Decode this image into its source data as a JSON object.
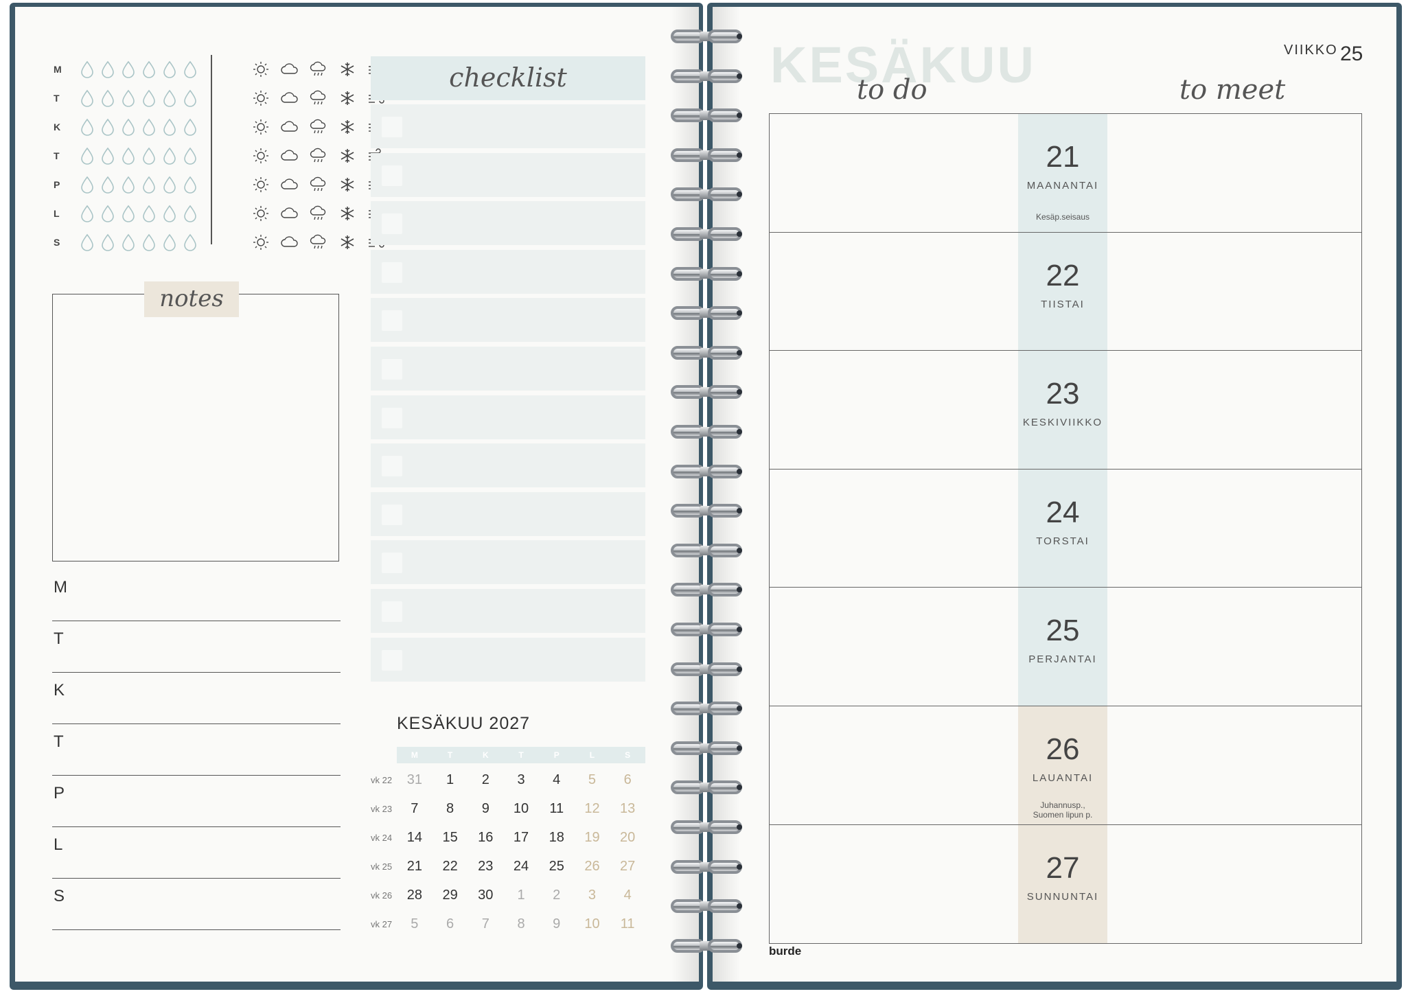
{
  "tracker": {
    "days": [
      "M",
      "T",
      "K",
      "T",
      "P",
      "L",
      "S"
    ],
    "drops_per_day": 6,
    "weather_icons": [
      "sun-icon",
      "cloud-icon",
      "rain-icon",
      "snow-icon",
      "wind-icon"
    ]
  },
  "notes": {
    "title": "notes"
  },
  "weekday_lines": [
    "M",
    "T",
    "K",
    "T",
    "P",
    "L",
    "S"
  ],
  "checklist": {
    "title": "checklist",
    "rows": 12
  },
  "mini_calendar": {
    "title": "KESÄKUU 2027",
    "headers": [
      "M",
      "T",
      "K",
      "T",
      "P",
      "L",
      "S"
    ],
    "weeks": [
      {
        "label": "vk 22",
        "days": [
          "31",
          "1",
          "2",
          "3",
          "4",
          "5",
          "6"
        ]
      },
      {
        "label": "vk 23",
        "days": [
          "7",
          "8",
          "9",
          "10",
          "11",
          "12",
          "13"
        ]
      },
      {
        "label": "vk 24",
        "days": [
          "14",
          "15",
          "16",
          "17",
          "18",
          "19",
          "20"
        ]
      },
      {
        "label": "vk 25",
        "days": [
          "21",
          "22",
          "23",
          "24",
          "25",
          "26",
          "27"
        ]
      },
      {
        "label": "vk 26",
        "days": [
          "28",
          "29",
          "30",
          "1",
          "2",
          "3",
          "4"
        ]
      },
      {
        "label": "vk 27",
        "days": [
          "5",
          "6",
          "7",
          "8",
          "9",
          "10",
          "11"
        ]
      }
    ]
  },
  "right_page": {
    "month": "KESÄKUU",
    "week_label": "VIIKKO",
    "week_number": "25",
    "col_todo": "to do",
    "col_meet": "to meet",
    "days": [
      {
        "num": "21",
        "name": "MAANANTAI",
        "note": "Kesäp.seisaus",
        "note2": "",
        "weekend": false
      },
      {
        "num": "22",
        "name": "TIISTAI",
        "note": "",
        "note2": "",
        "weekend": false
      },
      {
        "num": "23",
        "name": "KESKIVIIKKO",
        "note": "",
        "note2": "",
        "weekend": false
      },
      {
        "num": "24",
        "name": "TORSTAI",
        "note": "",
        "note2": "",
        "weekend": false
      },
      {
        "num": "25",
        "name": "PERJANTAI",
        "note": "",
        "note2": "",
        "weekend": false
      },
      {
        "num": "26",
        "name": "LAUANTAI",
        "note": "Juhannusp.,",
        "note2": "Suomen lipun p.",
        "weekend": true
      },
      {
        "num": "27",
        "name": "SUNNUNTAI",
        "note": "",
        "note2": "",
        "weekend": true
      }
    ],
    "brand": "burde"
  },
  "colors": {
    "cover": "#3d5868",
    "accent_blue": "#e2ecec",
    "accent_beige": "#ece6db",
    "weekend_text": "#c9b899"
  }
}
